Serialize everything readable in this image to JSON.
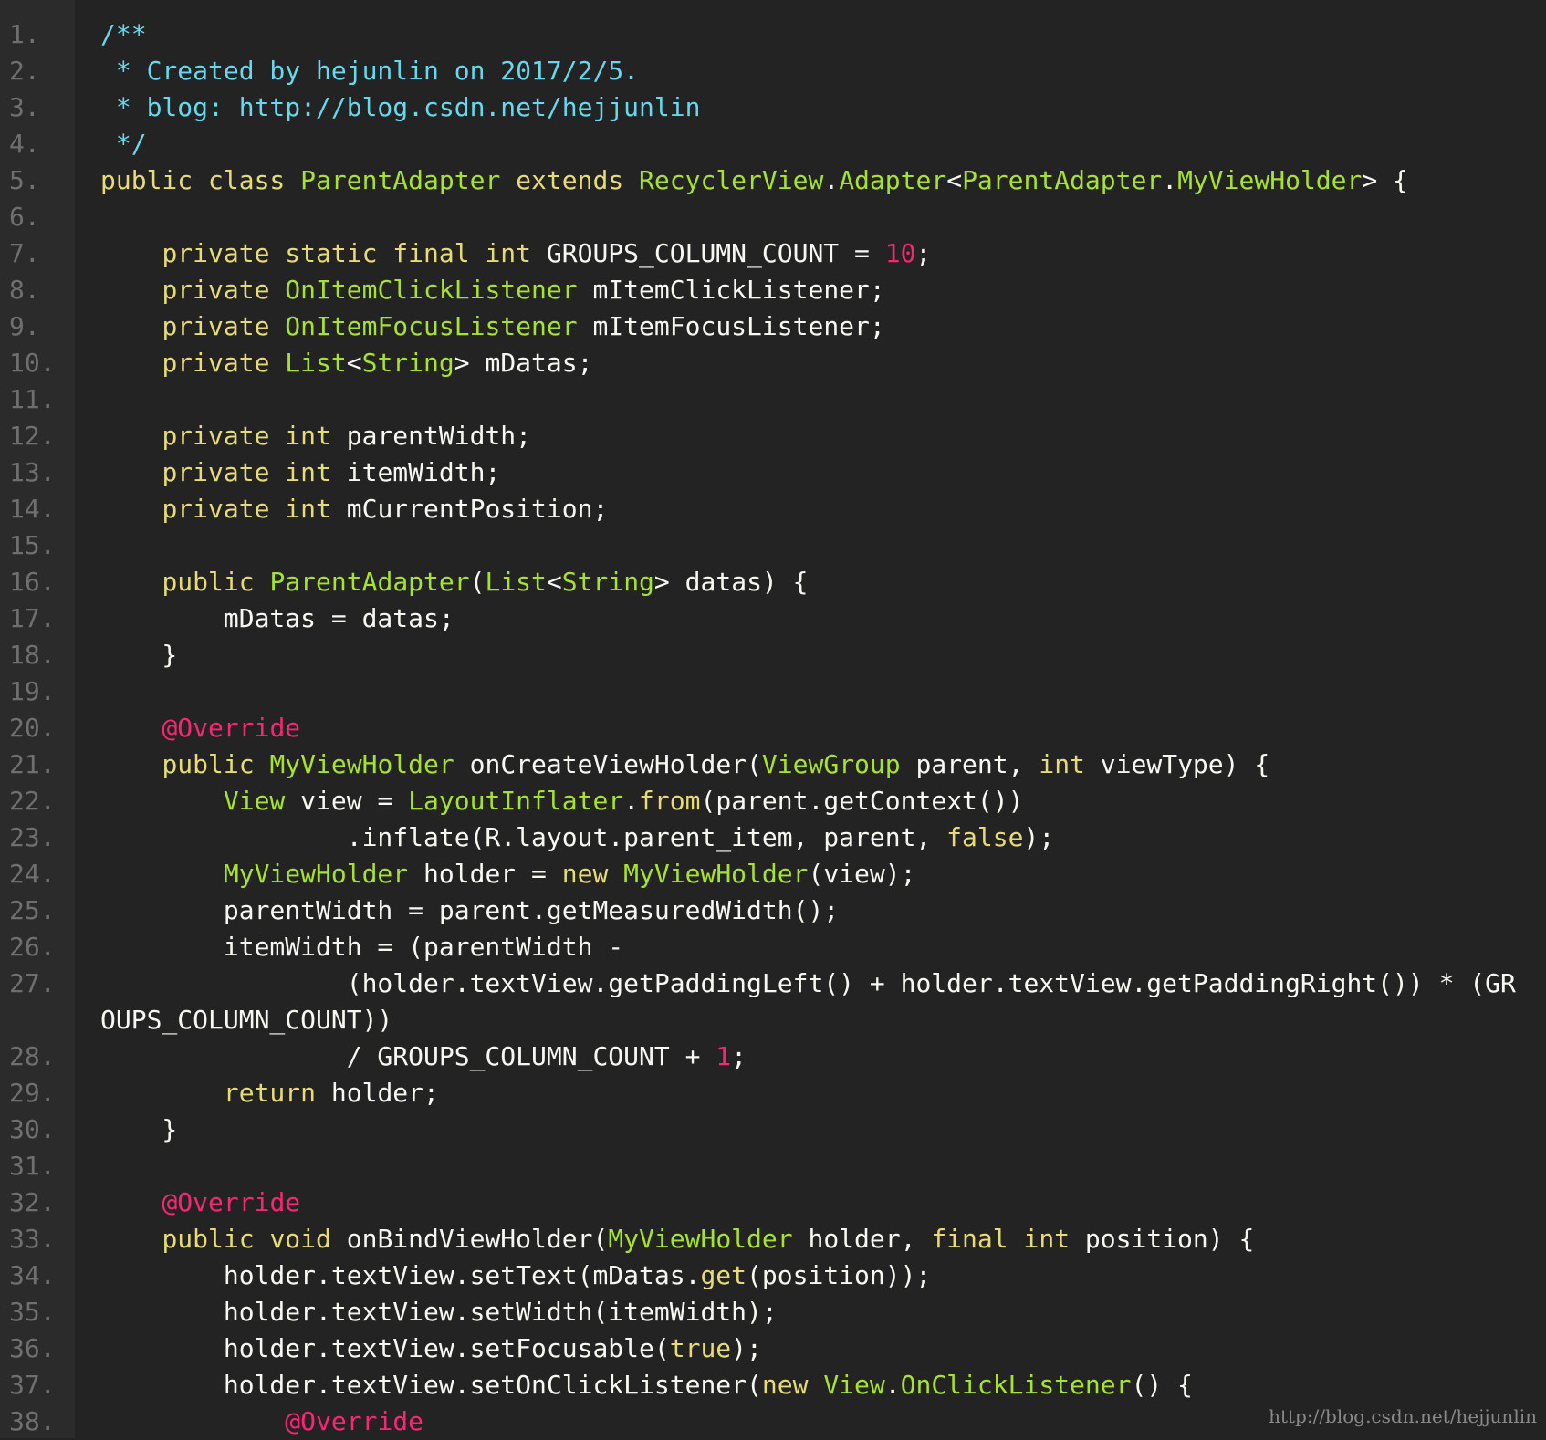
{
  "editor": {
    "theme_colors": {
      "background": "#232323",
      "gutter": "#2b2b2b",
      "comment": "#66d9ef",
      "keyword": "#e6db74",
      "type": "#a6e22e",
      "plain": "#f8f8f2",
      "number": "#f92672",
      "annotation": "#f92672"
    },
    "lines": [
      {
        "num": "1.",
        "tokens": [
          [
            "comment",
            "/**"
          ]
        ]
      },
      {
        "num": "2.",
        "tokens": [
          [
            "comment",
            " * Created by hejunlin on 2017/2/5."
          ]
        ]
      },
      {
        "num": "3.",
        "tokens": [
          [
            "comment",
            " * blog: http://blog.csdn.net/hejjunlin"
          ]
        ]
      },
      {
        "num": "4.",
        "tokens": [
          [
            "comment",
            " */"
          ]
        ]
      },
      {
        "num": "5.",
        "tokens": [
          [
            "kw",
            "public class "
          ],
          [
            "type",
            "ParentAdapter "
          ],
          [
            "kw",
            "extends "
          ],
          [
            "type",
            "RecyclerView"
          ],
          [
            "plain",
            "."
          ],
          [
            "type",
            "Adapter"
          ],
          [
            "plain",
            "<"
          ],
          [
            "type",
            "ParentAdapter"
          ],
          [
            "plain",
            "."
          ],
          [
            "type",
            "MyViewHolder"
          ],
          [
            "plain",
            "> {"
          ]
        ]
      },
      {
        "num": "6.",
        "tokens": []
      },
      {
        "num": "7.",
        "tokens": [
          [
            "plain",
            "    "
          ],
          [
            "kw",
            "private static final int "
          ],
          [
            "plain",
            "GROUPS_COLUMN_COUNT = "
          ],
          [
            "num",
            "10"
          ],
          [
            "plain",
            ";"
          ]
        ]
      },
      {
        "num": "8.",
        "tokens": [
          [
            "plain",
            "    "
          ],
          [
            "kw",
            "private "
          ],
          [
            "type",
            "OnItemClickListener "
          ],
          [
            "plain",
            "mItemClickListener;"
          ]
        ]
      },
      {
        "num": "9.",
        "tokens": [
          [
            "plain",
            "    "
          ],
          [
            "kw",
            "private "
          ],
          [
            "type",
            "OnItemFocusListener "
          ],
          [
            "plain",
            "mItemFocusListener;"
          ]
        ]
      },
      {
        "num": "10.",
        "tokens": [
          [
            "plain",
            "    "
          ],
          [
            "kw",
            "private "
          ],
          [
            "type",
            "List"
          ],
          [
            "plain",
            "<"
          ],
          [
            "type",
            "String"
          ],
          [
            "plain",
            "> mDatas;"
          ]
        ]
      },
      {
        "num": "11.",
        "tokens": []
      },
      {
        "num": "12.",
        "tokens": [
          [
            "plain",
            "    "
          ],
          [
            "kw",
            "private int "
          ],
          [
            "plain",
            "parentWidth;"
          ]
        ]
      },
      {
        "num": "13.",
        "tokens": [
          [
            "plain",
            "    "
          ],
          [
            "kw",
            "private int "
          ],
          [
            "plain",
            "itemWidth;"
          ]
        ]
      },
      {
        "num": "14.",
        "tokens": [
          [
            "plain",
            "    "
          ],
          [
            "kw",
            "private int "
          ],
          [
            "plain",
            "mCurrentPosition;"
          ]
        ]
      },
      {
        "num": "15.",
        "tokens": []
      },
      {
        "num": "16.",
        "tokens": [
          [
            "plain",
            "    "
          ],
          [
            "kw",
            "public "
          ],
          [
            "type",
            "ParentAdapter"
          ],
          [
            "plain",
            "("
          ],
          [
            "type",
            "List"
          ],
          [
            "plain",
            "<"
          ],
          [
            "type",
            "String"
          ],
          [
            "plain",
            "> datas) {"
          ]
        ]
      },
      {
        "num": "17.",
        "tokens": [
          [
            "plain",
            "        mDatas = datas;"
          ]
        ]
      },
      {
        "num": "18.",
        "tokens": [
          [
            "plain",
            "    }"
          ]
        ]
      },
      {
        "num": "19.",
        "tokens": []
      },
      {
        "num": "20.",
        "tokens": [
          [
            "plain",
            "    "
          ],
          [
            "ann",
            "@Override"
          ]
        ]
      },
      {
        "num": "21.",
        "tokens": [
          [
            "plain",
            "    "
          ],
          [
            "kw",
            "public "
          ],
          [
            "type",
            "MyViewHolder "
          ],
          [
            "plain",
            "onCreateViewHolder("
          ],
          [
            "type",
            "ViewGroup "
          ],
          [
            "plain",
            "parent, "
          ],
          [
            "kw",
            "int "
          ],
          [
            "plain",
            "viewType) {"
          ]
        ]
      },
      {
        "num": "22.",
        "tokens": [
          [
            "plain",
            "        "
          ],
          [
            "type",
            "View "
          ],
          [
            "plain",
            "view = "
          ],
          [
            "type",
            "LayoutInflater"
          ],
          [
            "plain",
            "."
          ],
          [
            "kw",
            "from"
          ],
          [
            "plain",
            "(parent.getContext())"
          ]
        ]
      },
      {
        "num": "23.",
        "tokens": [
          [
            "plain",
            "                .inflate(R.layout.parent_item, parent, "
          ],
          [
            "kw",
            "false"
          ],
          [
            "plain",
            ");"
          ]
        ]
      },
      {
        "num": "24.",
        "tokens": [
          [
            "plain",
            "        "
          ],
          [
            "type",
            "MyViewHolder "
          ],
          [
            "plain",
            "holder = "
          ],
          [
            "kw",
            "new "
          ],
          [
            "type",
            "MyViewHolder"
          ],
          [
            "plain",
            "(view);"
          ]
        ]
      },
      {
        "num": "25.",
        "tokens": [
          [
            "plain",
            "        parentWidth = parent.getMeasuredWidth();"
          ]
        ]
      },
      {
        "num": "26.",
        "tokens": [
          [
            "plain",
            "        itemWidth = (parentWidth -"
          ]
        ]
      },
      {
        "num": "27.",
        "tokens": [
          [
            "plain",
            "                (holder.textView.getPaddingLeft() + holder.textView.getPaddingRight()) * (GR"
          ]
        ]
      },
      {
        "num": "",
        "tokens": [
          [
            "plain",
            "OUPS_COLUMN_COUNT))"
          ]
        ]
      },
      {
        "num": "28.",
        "tokens": [
          [
            "plain",
            "                / GROUPS_COLUMN_COUNT + "
          ],
          [
            "num",
            "1"
          ],
          [
            "plain",
            ";"
          ]
        ]
      },
      {
        "num": "29.",
        "tokens": [
          [
            "plain",
            "        "
          ],
          [
            "kw",
            "return "
          ],
          [
            "plain",
            "holder;"
          ]
        ]
      },
      {
        "num": "30.",
        "tokens": [
          [
            "plain",
            "    }"
          ]
        ]
      },
      {
        "num": "31.",
        "tokens": []
      },
      {
        "num": "32.",
        "tokens": [
          [
            "plain",
            "    "
          ],
          [
            "ann",
            "@Override"
          ]
        ]
      },
      {
        "num": "33.",
        "tokens": [
          [
            "plain",
            "    "
          ],
          [
            "kw",
            "public void "
          ],
          [
            "plain",
            "onBindViewHolder("
          ],
          [
            "type",
            "MyViewHolder "
          ],
          [
            "plain",
            "holder, "
          ],
          [
            "kw",
            "final int "
          ],
          [
            "plain",
            "position) {"
          ]
        ]
      },
      {
        "num": "34.",
        "tokens": [
          [
            "plain",
            "        holder.textView.setText(mDatas."
          ],
          [
            "kw",
            "get"
          ],
          [
            "plain",
            "(position));"
          ]
        ]
      },
      {
        "num": "35.",
        "tokens": [
          [
            "plain",
            "        holder.textView.setWidth(itemWidth);"
          ]
        ]
      },
      {
        "num": "36.",
        "tokens": [
          [
            "plain",
            "        holder.textView.setFocusable("
          ],
          [
            "kw",
            "true"
          ],
          [
            "plain",
            ");"
          ]
        ]
      },
      {
        "num": "37.",
        "tokens": [
          [
            "plain",
            "        holder.textView.setOnClickListener("
          ],
          [
            "kw",
            "new "
          ],
          [
            "type",
            "View"
          ],
          [
            "plain",
            "."
          ],
          [
            "type",
            "OnClickListener"
          ],
          [
            "plain",
            "() {"
          ]
        ]
      },
      {
        "num": "38.",
        "tokens": [
          [
            "plain",
            "            "
          ],
          [
            "ann",
            "@Override"
          ]
        ]
      }
    ]
  },
  "watermark": "http://blog.csdn.net/hejjunlin"
}
